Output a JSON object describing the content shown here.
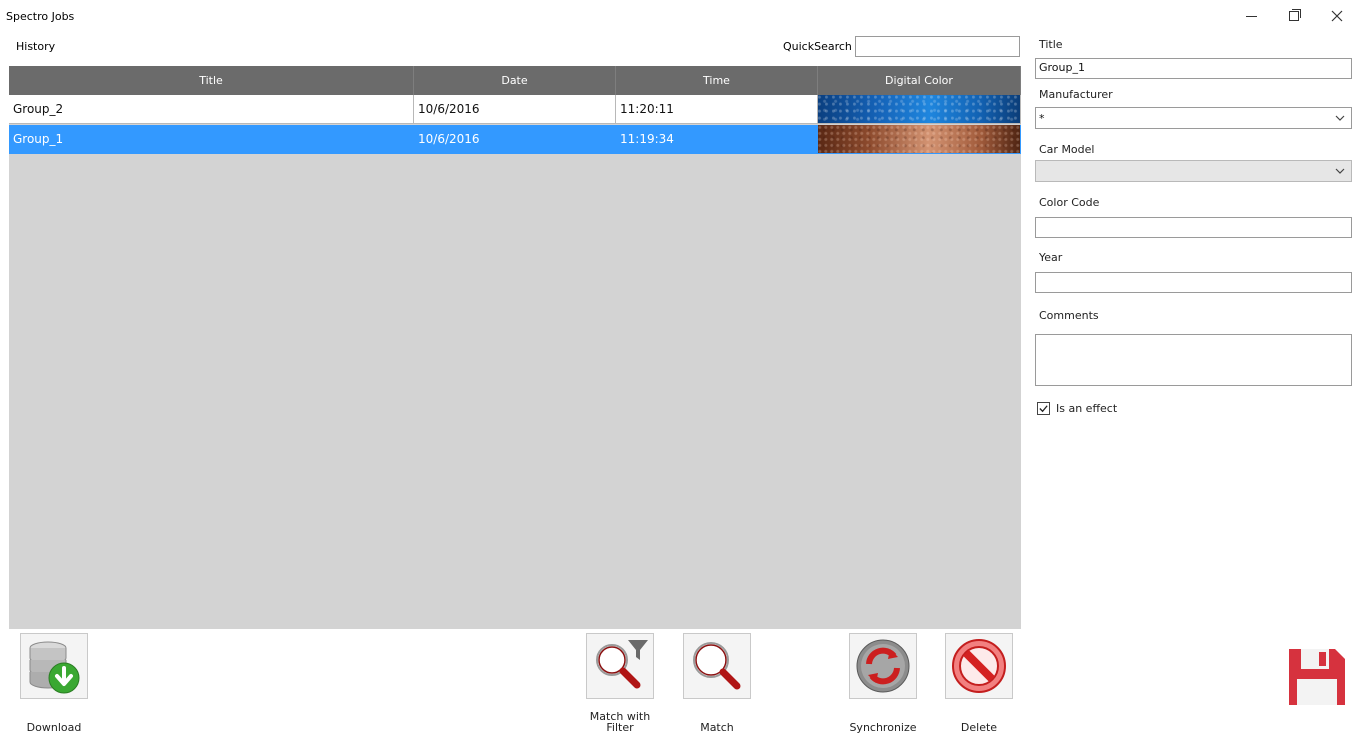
{
  "window": {
    "title": "Spectro Jobs"
  },
  "history": {
    "label": "History"
  },
  "quick_search": {
    "label": "QuickSearch",
    "value": ""
  },
  "grid": {
    "columns": [
      "Title",
      "Date",
      "Time",
      "Digital Color"
    ],
    "rows": [
      {
        "title": "Group_2",
        "date": "10/6/2016",
        "time": "11:20:11",
        "color": "metallic blue",
        "selected": false
      },
      {
        "title": "Group_1",
        "date": "10/6/2016",
        "time": "11:19:34",
        "color": "metallic copper",
        "selected": true
      }
    ],
    "selection_color": "#3399ff",
    "header_color": "#6b6b6b",
    "background_color": "#d3d3d3"
  },
  "toolbar": {
    "download_label": "Download",
    "match_filter_label": "Match with Filter",
    "match_label": "Match",
    "sync_label": "Synchronize",
    "delete_label": "Delete",
    "icons": {
      "download": "database-download-icon",
      "match_filter": "magnifier-filter-icon",
      "match": "magnifier-icon",
      "sync": "sync-icon",
      "delete": "delete-icon",
      "save": "save-icon"
    }
  },
  "form": {
    "title_label": "Title",
    "title_value": "Group_1",
    "manufacturer_label": "Manufacturer",
    "manufacturer_value": "*",
    "car_model_label": "Car Model",
    "car_model_value": "",
    "color_code_label": "Color Code",
    "color_code_value": "",
    "year_label": "Year",
    "year_value": "",
    "comments_label": "Comments",
    "comments_value": "",
    "is_effect_label": "Is an effect",
    "is_effect_checked": true
  }
}
